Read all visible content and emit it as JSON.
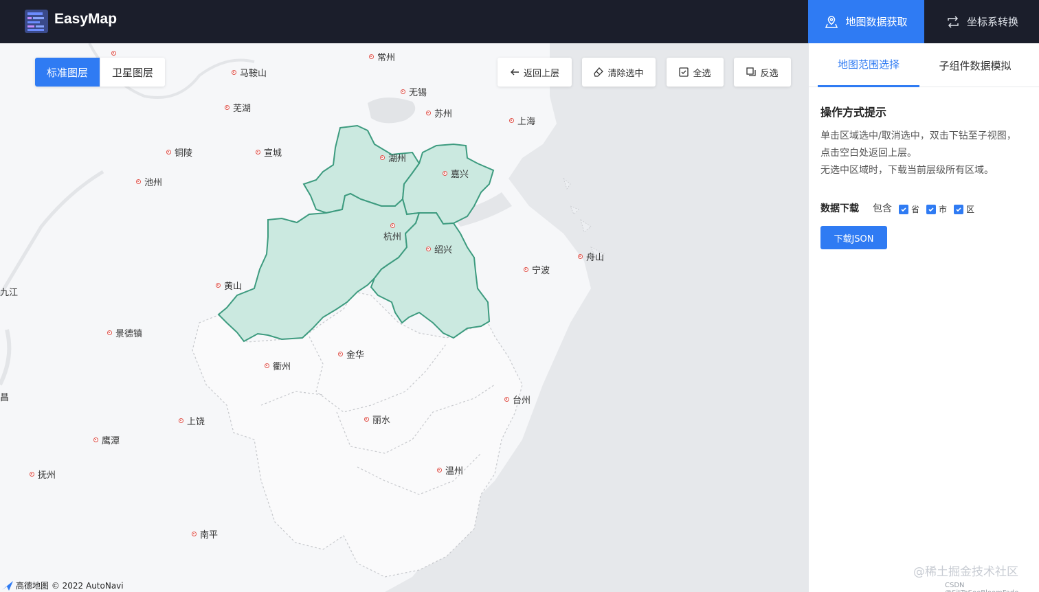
{
  "header": {
    "brand": "EasyMap",
    "nav": [
      {
        "label": "地图数据获取",
        "active": true
      },
      {
        "label": "坐标系转换",
        "active": false
      }
    ]
  },
  "map": {
    "layers": [
      {
        "label": "标准图层",
        "active": true
      },
      {
        "label": "卫星图层",
        "active": false
      }
    ],
    "tools": {
      "back": "返回上层",
      "clear": "清除选中",
      "select_all": "全选",
      "invert": "反选"
    },
    "cities": [
      {
        "name": "常州",
        "key": "changzhou"
      },
      {
        "name": "马鞍山",
        "key": "maanshan"
      },
      {
        "name": "无锡",
        "key": "wuxi"
      },
      {
        "name": "芜湖",
        "key": "wuhu"
      },
      {
        "name": "苏州",
        "key": "suzhou"
      },
      {
        "name": "上海",
        "key": "shanghai"
      },
      {
        "name": "铜陵",
        "key": "tongling"
      },
      {
        "name": "宣城",
        "key": "xuancheng"
      },
      {
        "name": "湖州",
        "key": "huzhou"
      },
      {
        "name": "嘉兴",
        "key": "jiaxing"
      },
      {
        "name": "池州",
        "key": "chizhou"
      },
      {
        "name": "杭州",
        "key": "hangzhou"
      },
      {
        "name": "绍兴",
        "key": "shaoxing"
      },
      {
        "name": "舟山",
        "key": "zhoushan"
      },
      {
        "name": "宁波",
        "key": "ningbo"
      },
      {
        "name": "黄山",
        "key": "huangshan"
      },
      {
        "name": "九江",
        "key": "jiujiang"
      },
      {
        "name": "景德镇",
        "key": "jingdezhen"
      },
      {
        "name": "金华",
        "key": "jinhua"
      },
      {
        "name": "衢州",
        "key": "quzhou"
      },
      {
        "name": "台州",
        "key": "taizhou"
      },
      {
        "name": "昌",
        "key": "nanchang"
      },
      {
        "name": "上饶",
        "key": "shangrao"
      },
      {
        "name": "丽水",
        "key": "lishui"
      },
      {
        "name": "鹰潭",
        "key": "yingtan"
      },
      {
        "name": "温州",
        "key": "wenzhou"
      },
      {
        "name": "抚州",
        "key": "fuzhou"
      },
      {
        "name": "南平",
        "key": "nanping"
      }
    ],
    "attribution": "高德地图 © 2022 AutoNavi"
  },
  "panel": {
    "tabs": [
      {
        "label": "地图范围选择",
        "active": true
      },
      {
        "label": "子组件数据模拟",
        "active": false
      }
    ],
    "title": "操作方式提示",
    "hints": [
      "单击区域选中/取消选中，双击下钻至子视图，",
      "点击空白处返回上层。",
      "无选中区域时，下载当前层级所有区域。"
    ],
    "download_label": "数据下载",
    "contains_label": "包含",
    "checkboxes": [
      {
        "label": "省",
        "checked": true
      },
      {
        "label": "市",
        "checked": true
      },
      {
        "label": "区",
        "checked": true
      }
    ],
    "download_button": "下载JSON",
    "watermark": "@稀土掘金技术社区",
    "watermark_small": "CSDN @SitToSeeBloomFade"
  },
  "colors": {
    "accent": "#2f7bf3",
    "header_bg": "#1b1e2b",
    "selected_fill": "#cbe9e0",
    "selected_stroke": "#3d9b7f",
    "city_dot": "#e0524a"
  }
}
